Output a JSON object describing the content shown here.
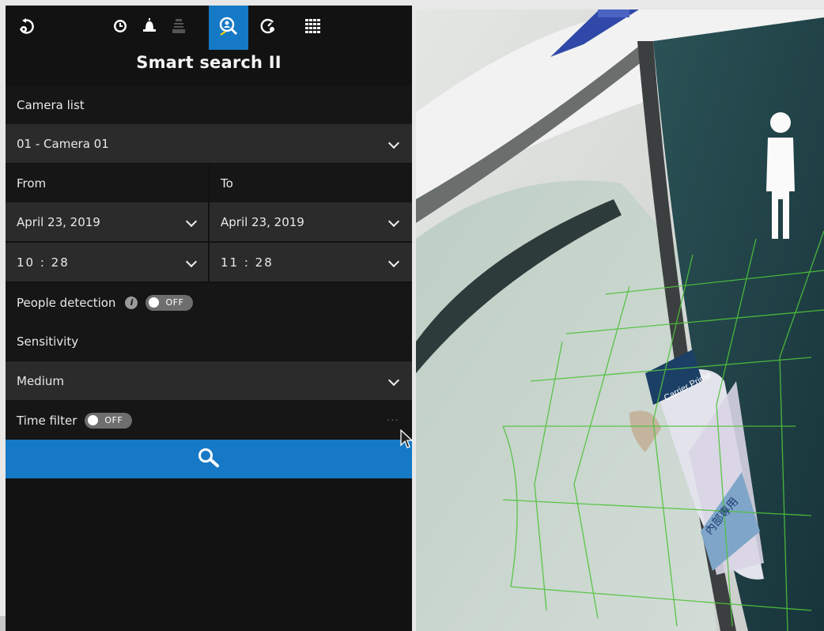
{
  "toolbar": {
    "icons": [
      "back-icon",
      "clock-icon",
      "bell-icon",
      "monitor-icon",
      "smart-search-icon",
      "speedometer-icon",
      "grid-icon"
    ],
    "active": "smart-search-icon",
    "accent_color": "#1679c5"
  },
  "page": {
    "title": "Smart search II"
  },
  "camera": {
    "label": "Camera list",
    "selected": "01 - Camera 01"
  },
  "range": {
    "from_label": "From",
    "to_label": "To",
    "from_date": "April 23, 2019",
    "to_date": "April 23, 2019",
    "from_time": "10 : 28",
    "to_time": "11 : 28"
  },
  "people_detection": {
    "label": "People detection",
    "info_glyph": "i",
    "toggle": "OFF"
  },
  "sensitivity": {
    "label": "Sensitivity",
    "selected": "Medium"
  },
  "time_filter": {
    "label": "Time filter",
    "toggle": "OFF",
    "more": "···"
  },
  "search": {
    "icon": "search-icon"
  },
  "video": {
    "description_icon": "person-icon",
    "sign_text_1": "Carrier Prime",
    "sign_text_2": "內部專用"
  }
}
